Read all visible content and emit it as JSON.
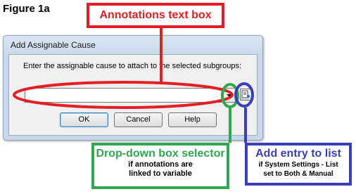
{
  "figure": {
    "label": "Figure 1a"
  },
  "dialog": {
    "title": "Add Assignable Cause",
    "prompt": "Enter the assignable cause to attach to the selected subgroups:",
    "annotation_input": {
      "value": "",
      "placeholder": ""
    },
    "dropdown_icon": "chevron-down-icon",
    "add_entry_icon": "add-entry-icon",
    "buttons": {
      "ok": "OK",
      "cancel": "Cancel",
      "help": "Help"
    }
  },
  "callouts": {
    "annotations": {
      "heading": "Annotations text box",
      "color": "#e31e24"
    },
    "dropdown": {
      "heading": "Drop-down box selector",
      "note_line1": "if annotations are",
      "note_line2": "linked to variable",
      "color": "#2fa84f"
    },
    "add_entry": {
      "heading": "Add entry to list",
      "note_line1": "if System Settings - List",
      "note_line2": "set to Both & Manual",
      "color": "#3a3fb8"
    }
  }
}
